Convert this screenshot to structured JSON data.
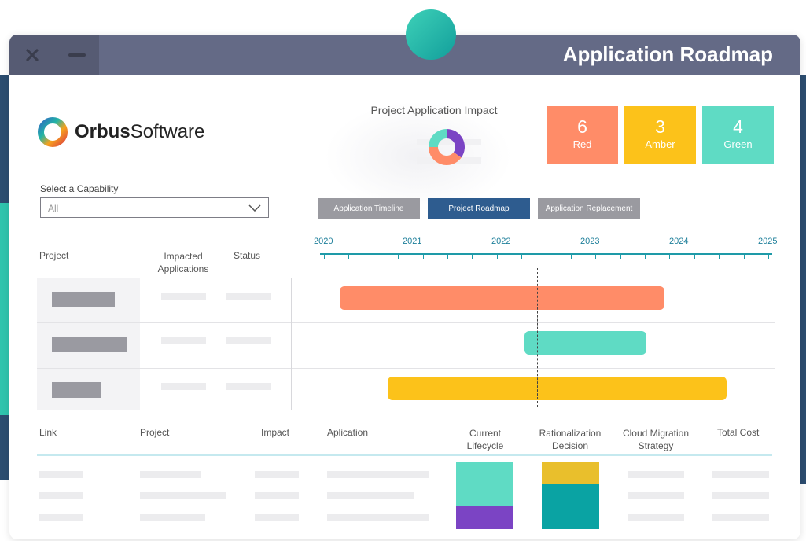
{
  "window": {
    "title": "Application Roadmap"
  },
  "logo": {
    "bold": "Orbus",
    "light": "Software"
  },
  "impact": {
    "title": "Project Application Impact",
    "chart_data": {
      "type": "pie",
      "categories": [
        "Purple",
        "Orange",
        "Teal"
      ],
      "values": [
        35,
        40,
        25
      ],
      "colors": [
        "#7b44c4",
        "#ff8c68",
        "#5fdbc4"
      ]
    }
  },
  "kpis": [
    {
      "value": "6",
      "label": "Red",
      "color": "#ff8c68"
    },
    {
      "value": "3",
      "label": "Amber",
      "color": "#fcc21a"
    },
    {
      "value": "4",
      "label": "Green",
      "color": "#5fdbc4"
    }
  ],
  "capability": {
    "label": "Select a Capability",
    "value": "All"
  },
  "buttons": [
    {
      "label": "Application Timeline",
      "color": "#9a9aa0"
    },
    {
      "label": "Project Roadmap",
      "color": "#2e5c8f"
    },
    {
      "label": "Application Replacement",
      "color": "#9a9aa0"
    }
  ],
  "roadmap_headers": {
    "project": "Project",
    "impacted": "Impacted Applications",
    "status": "Status"
  },
  "timeline": {
    "years": [
      "2020",
      "2021",
      "2022",
      "2023",
      "2024",
      "2025"
    ],
    "today": 2022.4
  },
  "gantt": [
    {
      "start": 2020.18,
      "end": 2023.83,
      "color": "#ff8c68"
    },
    {
      "start": 2022.26,
      "end": 2023.63,
      "color": "#5fdbc4"
    },
    {
      "start": 2020.72,
      "end": 2024.53,
      "color": "#fcc21a"
    }
  ],
  "table_headers": {
    "link": "Link",
    "project": "Project",
    "impact": "Impact",
    "application": "Aplication",
    "lifecycle": "Current Lifecycle",
    "rationalization": "Rationalization Decision",
    "cloud": "Cloud Migration Strategy",
    "cost": "Total Cost"
  },
  "lifecycle_colors": {
    "teal": "#5fdbc4",
    "purple": "#7b44c4"
  },
  "rationalization_colors": {
    "amber": "#e9bf2c",
    "teal": "#0aa3a3"
  }
}
